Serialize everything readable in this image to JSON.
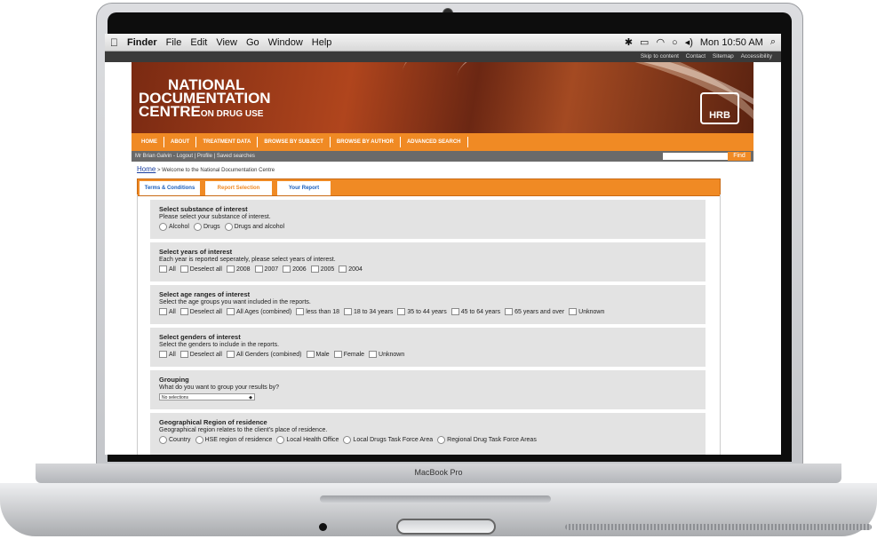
{
  "menubar": {
    "apple": "",
    "app": "Finder",
    "items": [
      "File",
      "Edit",
      "View",
      "Go",
      "Window",
      "Help"
    ],
    "clock": "Mon 10:50 AM"
  },
  "site": {
    "toplinks": [
      "Skip to content",
      "Contact",
      "Sitemap",
      "Accessibility"
    ],
    "logo_line1": "NATIONAL",
    "logo_line2": "DOCUMENTATION",
    "logo_line3": "CENTRE",
    "logo_line3_small": "ON DRUG USE",
    "hrb_label": "HRB",
    "nav": [
      "HOME",
      "ABOUT",
      "TREATMENT DATA",
      "BROWSE BY SUBJECT",
      "BROWSE BY AUTHOR",
      "ADVANCED SEARCH"
    ],
    "user_bar": "Mr Brian Galvin - Logout | Profile | Saved searches",
    "find_label": "Find",
    "breadcrumb_home": "Home",
    "breadcrumb_rest": " > Welcome to the National Documentation Centre",
    "tabs": [
      "Terms & Conditions",
      "Report Selection",
      "Your Report"
    ]
  },
  "sections": {
    "substance": {
      "heading": "Select substance of interest",
      "desc": "Please select your substance of interest.",
      "options": [
        "Alcohol",
        "Drugs",
        "Drugs and alcohol"
      ]
    },
    "years": {
      "heading": "Select years of interest",
      "desc": "Each year is reported seperately, please select years of interest.",
      "options": [
        "All",
        "Deselect all",
        "2008",
        "2007",
        "2006",
        "2005",
        "2004"
      ]
    },
    "ages": {
      "heading": "Select age ranges of interest",
      "desc": "Select the age groups you want included in the reports.",
      "options": [
        "All",
        "Deselect all",
        "All Ages (combined)",
        "less than 18",
        "18 to 34 years",
        "35 to 44 years",
        "45 to 64 years",
        "65 years and over",
        "Unknown"
      ]
    },
    "genders": {
      "heading": "Select genders of interest",
      "desc": "Select the genders to include in the reports.",
      "options": [
        "All",
        "Deselect all",
        "All Genders (combined)",
        "Male",
        "Female",
        "Unknown"
      ]
    },
    "grouping": {
      "heading": "Grouping",
      "desc": "What do you want to group your results by?",
      "select_value": "No selections"
    },
    "region": {
      "heading": "Geographical Region of residence",
      "desc": "Geographical region relates to the client's place of residence.",
      "options": [
        "Country",
        "HSE region of residence",
        "Local Health Office",
        "Local Drugs Task Force Area",
        "Regional Drug Task Force Areas"
      ]
    }
  },
  "device": {
    "brand": "MacBook Pro"
  }
}
